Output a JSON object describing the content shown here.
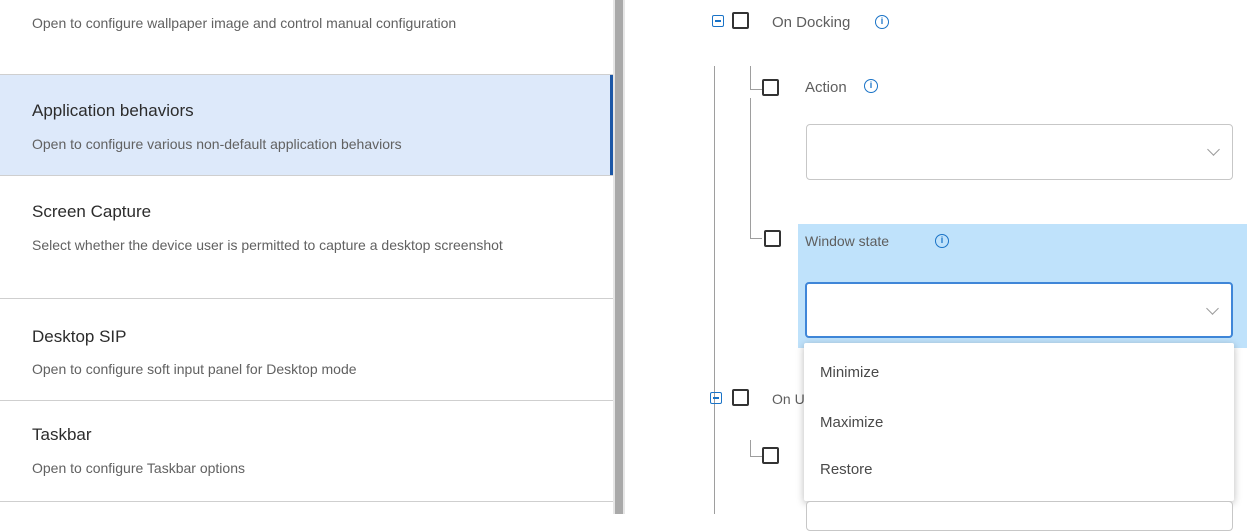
{
  "settings_list": {
    "items": [
      {
        "title": "",
        "description": "Open to configure wallpaper image and control manual configuration"
      },
      {
        "title": "Application behaviors",
        "description": "Open to configure various non-default application behaviors"
      },
      {
        "title": "Screen Capture",
        "description": "Select whether the device user is permitted to capture a desktop screenshot"
      },
      {
        "title": "Desktop SIP",
        "description": "Open to configure soft input panel for Desktop mode"
      },
      {
        "title": "Taskbar",
        "description": "Open to configure Taskbar options"
      }
    ],
    "selected_index": 1
  },
  "tree": {
    "on_docking": {
      "label": "On Docking"
    },
    "action": {
      "label": "Action",
      "value": ""
    },
    "window_state": {
      "label": "Window state",
      "value": ""
    },
    "on_undocking": {
      "label_partial": "On U"
    }
  },
  "dropdown": {
    "options": [
      "Minimize",
      "Maximize",
      "Restore"
    ]
  },
  "colors": {
    "selected_bg": "#dde9fa",
    "selected_accent": "#1c57a6",
    "info_blue": "#1a73c7",
    "highlight": "#bfe2fb"
  }
}
